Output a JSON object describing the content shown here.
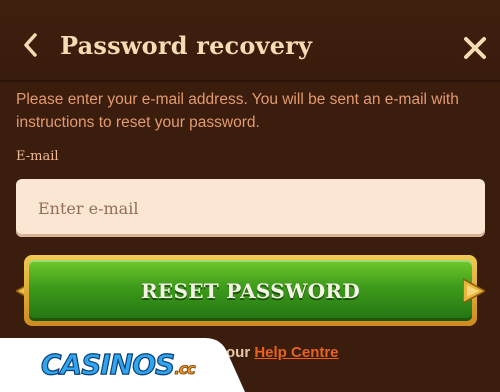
{
  "header": {
    "title": "Password recovery",
    "back_icon": "chevron-left-icon",
    "close_icon": "close-icon"
  },
  "form": {
    "description": "Please enter your e-mail address. You will be sent an e-mail with instructions to reset your password.",
    "email_label": "E-mail",
    "email_placeholder": "Enter e-mail",
    "email_value": "",
    "submit_label": "RESET PASSWORD"
  },
  "footer": {
    "help_prefix": "our",
    "help_link": "Help Centre"
  },
  "watermark": {
    "text": "CASINOS",
    "suffix": ".cc"
  },
  "colors": {
    "background": "#3b1d0e",
    "title": "#f6dcb3",
    "description": "#e39a6f",
    "input_bg": "#fbe6d3",
    "button_green": "#3d9a1b",
    "button_gold": "#f0ca52",
    "link": "#e8621d"
  }
}
